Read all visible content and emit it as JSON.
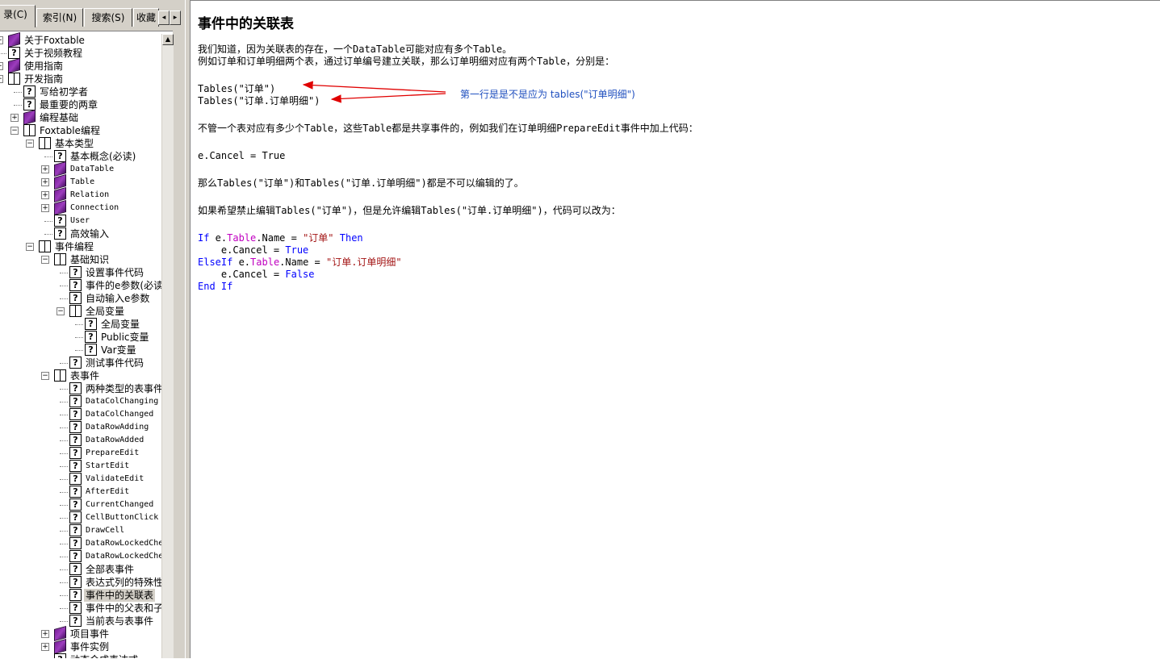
{
  "tabs": [
    {
      "label": "录(C)",
      "active": true
    },
    {
      "label": "索引(N)",
      "active": false
    },
    {
      "label": "搜索(S)",
      "active": false
    },
    {
      "label": "收藏",
      "active": false
    }
  ],
  "tab_scroll": {
    "left": "◂",
    "right": "▸"
  },
  "tree": [
    {
      "label": "关于Foxtable",
      "depth": 0,
      "icon": "book-closed-icon",
      "expander": "+"
    },
    {
      "label": "关于视频教程",
      "depth": 0,
      "icon": "help-page-icon"
    },
    {
      "label": "使用指南",
      "depth": 0,
      "icon": "book-closed-icon",
      "expander": "+"
    },
    {
      "label": "开发指南",
      "depth": 0,
      "icon": "book-open-icon",
      "expander": "-"
    },
    {
      "label": "写给初学者",
      "depth": 1,
      "icon": "help-page-icon"
    },
    {
      "label": "最重要的两章",
      "depth": 1,
      "icon": "help-page-icon"
    },
    {
      "label": "编程基础",
      "depth": 1,
      "icon": "book-closed-icon",
      "expander": "+"
    },
    {
      "label": "Foxtable编程",
      "depth": 1,
      "icon": "book-open-icon",
      "expander": "-"
    },
    {
      "label": "基本类型",
      "depth": 2,
      "icon": "book-open-icon",
      "expander": "-"
    },
    {
      "label": "基本概念(必读)",
      "depth": 3,
      "icon": "help-page-icon"
    },
    {
      "label": "DataTable",
      "depth": 3,
      "icon": "book-closed-icon",
      "expander": "+",
      "mono": true
    },
    {
      "label": "Table",
      "depth": 3,
      "icon": "book-closed-icon",
      "expander": "+",
      "mono": true
    },
    {
      "label": "Relation",
      "depth": 3,
      "icon": "book-closed-icon",
      "expander": "+",
      "mono": true
    },
    {
      "label": "Connection",
      "depth": 3,
      "icon": "book-closed-icon",
      "expander": "+",
      "mono": true
    },
    {
      "label": "User",
      "depth": 3,
      "icon": "help-page-icon",
      "mono": true
    },
    {
      "label": "高效输入",
      "depth": 3,
      "icon": "help-page-icon"
    },
    {
      "label": "事件编程",
      "depth": 2,
      "icon": "book-open-icon",
      "expander": "-"
    },
    {
      "label": "基础知识",
      "depth": 3,
      "icon": "book-open-icon",
      "expander": "-"
    },
    {
      "label": "设置事件代码",
      "depth": 4,
      "icon": "help-page-icon"
    },
    {
      "label": "事件的e参数(必读",
      "depth": 4,
      "icon": "help-page-icon"
    },
    {
      "label": "自动输入e参数",
      "depth": 4,
      "icon": "help-page-icon"
    },
    {
      "label": "全局变量",
      "depth": 4,
      "icon": "book-open-icon",
      "expander": "-"
    },
    {
      "label": "全局变量",
      "depth": 5,
      "icon": "help-page-icon"
    },
    {
      "label": "Public变量",
      "depth": 5,
      "icon": "help-page-icon"
    },
    {
      "label": "Var变量",
      "depth": 5,
      "icon": "help-page-icon"
    },
    {
      "label": "测试事件代码",
      "depth": 4,
      "icon": "help-page-icon"
    },
    {
      "label": "表事件",
      "depth": 3,
      "icon": "book-open-icon",
      "expander": "-"
    },
    {
      "label": "两种类型的表事件",
      "depth": 4,
      "icon": "help-page-icon"
    },
    {
      "label": "DataColChanging",
      "depth": 4,
      "icon": "help-page-icon",
      "mono": true
    },
    {
      "label": "DataColChanged",
      "depth": 4,
      "icon": "help-page-icon",
      "mono": true
    },
    {
      "label": "DataRowAdding",
      "depth": 4,
      "icon": "help-page-icon",
      "mono": true
    },
    {
      "label": "DataRowAdded",
      "depth": 4,
      "icon": "help-page-icon",
      "mono": true
    },
    {
      "label": "PrepareEdit",
      "depth": 4,
      "icon": "help-page-icon",
      "mono": true
    },
    {
      "label": "StartEdit",
      "depth": 4,
      "icon": "help-page-icon",
      "mono": true
    },
    {
      "label": "ValidateEdit",
      "depth": 4,
      "icon": "help-page-icon",
      "mono": true
    },
    {
      "label": "AfterEdit",
      "depth": 4,
      "icon": "help-page-icon",
      "mono": true
    },
    {
      "label": "CurrentChanged",
      "depth": 4,
      "icon": "help-page-icon",
      "mono": true
    },
    {
      "label": "CellButtonClick",
      "depth": 4,
      "icon": "help-page-icon",
      "mono": true
    },
    {
      "label": "DrawCell",
      "depth": 4,
      "icon": "help-page-icon",
      "mono": true
    },
    {
      "label": "DataRowLockedChe",
      "depth": 4,
      "icon": "help-page-icon",
      "mono": true
    },
    {
      "label": "DataRowLockedChe",
      "depth": 4,
      "icon": "help-page-icon",
      "mono": true
    },
    {
      "label": "全部表事件",
      "depth": 4,
      "icon": "help-page-icon"
    },
    {
      "label": "表达式列的特殊性",
      "depth": 4,
      "icon": "help-page-icon"
    },
    {
      "label": "事件中的关联表",
      "depth": 4,
      "icon": "help-page-icon",
      "selected": true
    },
    {
      "label": "事件中的父表和子",
      "depth": 4,
      "icon": "help-page-icon"
    },
    {
      "label": "当前表与表事件",
      "depth": 4,
      "icon": "help-page-icon"
    },
    {
      "label": "项目事件",
      "depth": 3,
      "icon": "book-closed-icon",
      "expander": "+"
    },
    {
      "label": "事件实例",
      "depth": 3,
      "icon": "book-closed-icon",
      "expander": "+"
    },
    {
      "label": "动态合成表达式",
      "depth": 3,
      "icon": "help-page-icon"
    }
  ],
  "scrollbar": {
    "up": "▲"
  },
  "content": {
    "title": "事件中的关联表",
    "p1": "我们知道，因为关联表的存在，一个DataTable可能对应有多个Table。",
    "p2": "例如订单和订单明细两个表，通过订单编号建立关联，那么订单明细对应有两个Table，分别是：",
    "tables_line1": "Tables(\"订单\")",
    "tables_line2": "Tables(\"订单.订单明细\")",
    "annotation": "第一行是是不是应为  tables(\"订单明细\")",
    "p3": "不管一个表对应有多少个Table，这些Table都是共享事件的，例如我们在订单明细PrepareEdit事件中加上代码：",
    "code1": "e.Cancel = True",
    "p4": "那么Tables(\"订单\")和Tables(\"订单.订单明细\")都是不可以编辑的了。",
    "p5": "如果希望禁止编辑Tables(\"订单\")，但是允许编辑Tables(\"订单.订单明细\")，代码可以改为：",
    "code2": {
      "kw_if": "If",
      "e1": " e.",
      "table1": "Table",
      "name1": ".Name = ",
      "str1": "\"订单\"",
      "kw_then": " Then",
      "line2_indent": "    e.Cancel = ",
      "true1": "True",
      "kw_elseif": "ElseIf",
      "e2": " e.",
      "table2": "Table",
      "name2": ".Name = ",
      "str2": "\"订单.订单明细\"",
      "line4_indent": "    e.Cancel = ",
      "false1": "False",
      "kw_end": "End",
      "kw_endif": " If"
    }
  },
  "colors": {
    "keyword": "#0000ff",
    "type": "#c000c0",
    "string": "#a31515",
    "annotation": "#1f4fbf",
    "arrow": "#e00000"
  }
}
